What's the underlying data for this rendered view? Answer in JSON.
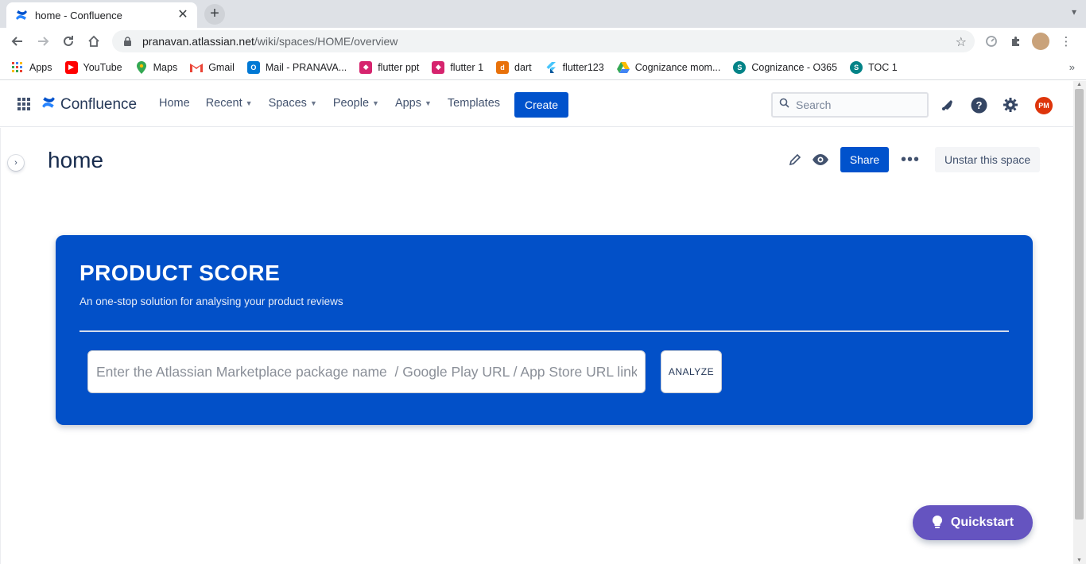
{
  "browser": {
    "tab_title": "home - Confluence",
    "close_glyph": "✕",
    "new_tab_glyph": "+",
    "url_host": "pranavan.atlassian.net",
    "url_path": "/wiki/spaces/HOME/overview",
    "bookmarks": [
      {
        "label": "Apps",
        "icon": "apps-grid-icon",
        "color": "#4285f4"
      },
      {
        "label": "YouTube",
        "icon": "youtube-icon",
        "color": "#ff0000"
      },
      {
        "label": "Maps",
        "icon": "maps-icon",
        "color": "#34a853"
      },
      {
        "label": "Gmail",
        "icon": "gmail-icon",
        "color": "#ea4335"
      },
      {
        "label": "Mail - PRANAVA...",
        "icon": "outlook-icon",
        "color": "#0078d4"
      },
      {
        "label": "flutter ppt",
        "icon": "flutter-ppt-icon",
        "color": "#d6246e"
      },
      {
        "label": "flutter 1",
        "icon": "flutter-1-icon",
        "color": "#d6246e"
      },
      {
        "label": "dart",
        "icon": "dart-icon",
        "color": "#e8710a"
      },
      {
        "label": "flutter123",
        "icon": "flutter-icon",
        "color": "#02569b"
      },
      {
        "label": "Cognizance mom...",
        "icon": "google-drive-icon",
        "color": "#fbbc04"
      },
      {
        "label": "Cognizance - O365",
        "icon": "sharepoint-icon",
        "color": "#038387"
      },
      {
        "label": "TOC 1",
        "icon": "sharepoint-icon",
        "color": "#038387"
      }
    ],
    "bookmarks_more": "»"
  },
  "confluence": {
    "product_name": "Confluence",
    "nav": [
      {
        "label": "Home",
        "dropdown": false
      },
      {
        "label": "Recent",
        "dropdown": true
      },
      {
        "label": "Spaces",
        "dropdown": true
      },
      {
        "label": "People",
        "dropdown": true
      },
      {
        "label": "Apps",
        "dropdown": true
      },
      {
        "label": "Templates",
        "dropdown": false
      }
    ],
    "create_label": "Create",
    "search_placeholder": "Search",
    "avatar_initials": "PM",
    "brand_color": "#0052cc"
  },
  "page": {
    "title": "home",
    "share_label": "Share",
    "unstar_label": "Unstar this space",
    "more_glyph": "•••"
  },
  "product_score": {
    "title": "PRODUCT SCORE",
    "subtitle": "An one-stop solution for analysing your product reviews",
    "input_placeholder": "Enter the Atlassian Marketplace package name  / Google Play URL / App Store URL link",
    "analyze_label": "ANALYZE",
    "card_color": "#0250c8"
  },
  "quickstart_label": "Quickstart"
}
